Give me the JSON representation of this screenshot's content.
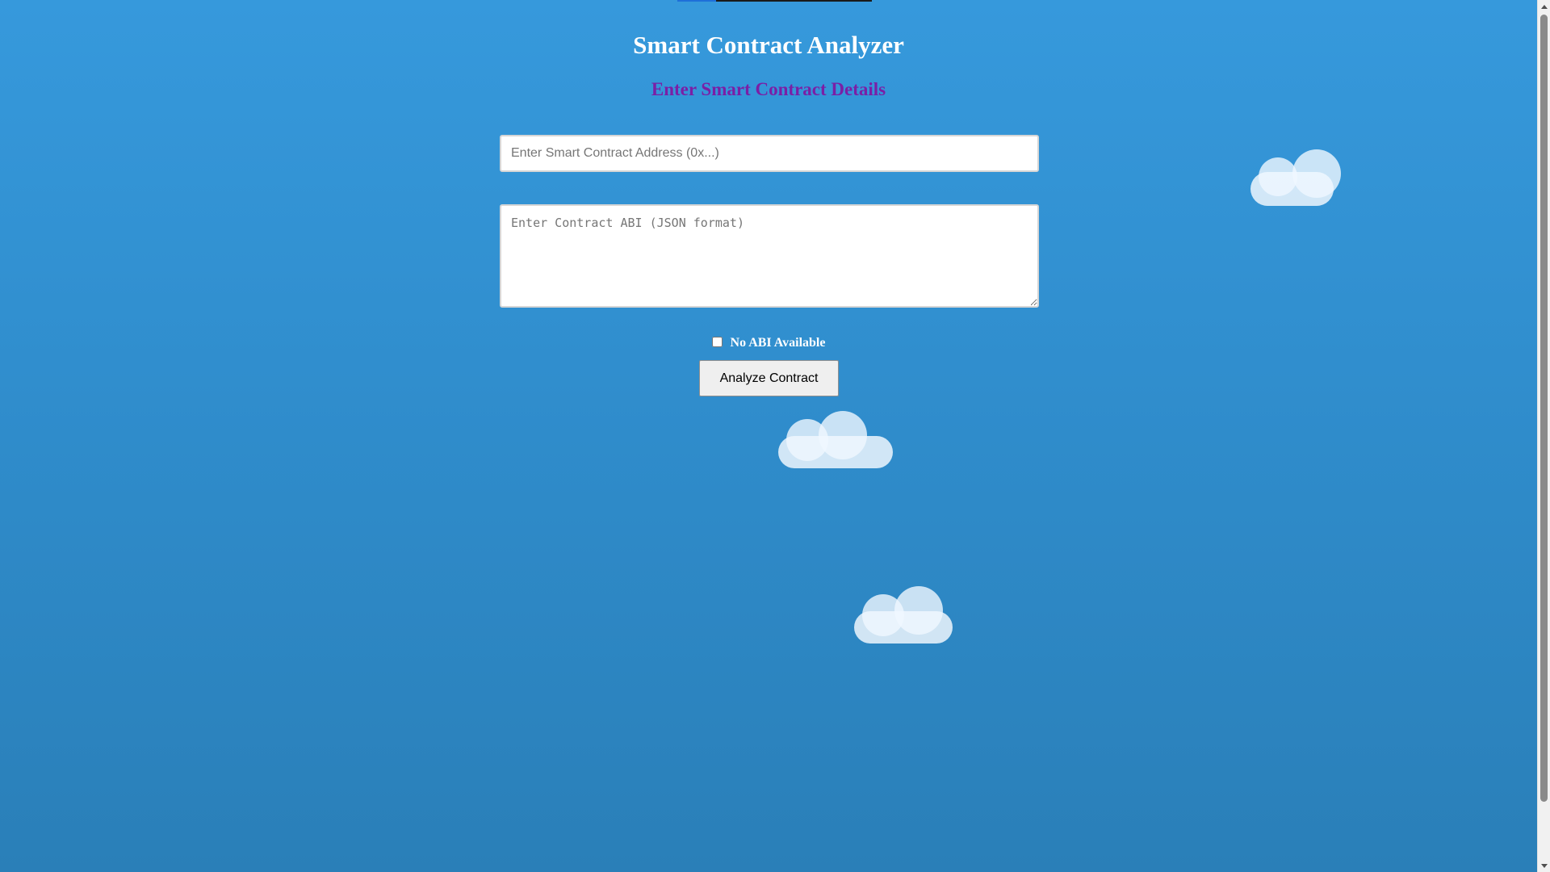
{
  "page": {
    "title": "Smart Contract Analyzer",
    "subtitle": "Enter Smart Contract Details",
    "loading_progress_percent": 20
  },
  "form": {
    "address_placeholder": "Enter Smart Contract Address (0x...)",
    "address_value": "",
    "abi_placeholder": "Enter Contract ABI (JSON format)",
    "abi_value": "",
    "no_abi_label": "No ABI Available",
    "no_abi_checked": false,
    "analyze_button_label": "Analyze Contract"
  },
  "colors": {
    "background_top": "#3699dc",
    "background_bottom": "#2a7fb8",
    "title": "#ffffff",
    "subtitle": "#7a1fa6",
    "progress_fill": "#1e6fd9"
  },
  "icons": {
    "clouds": [
      "cloud-icon",
      "cloud-icon",
      "cloud-icon"
    ]
  }
}
